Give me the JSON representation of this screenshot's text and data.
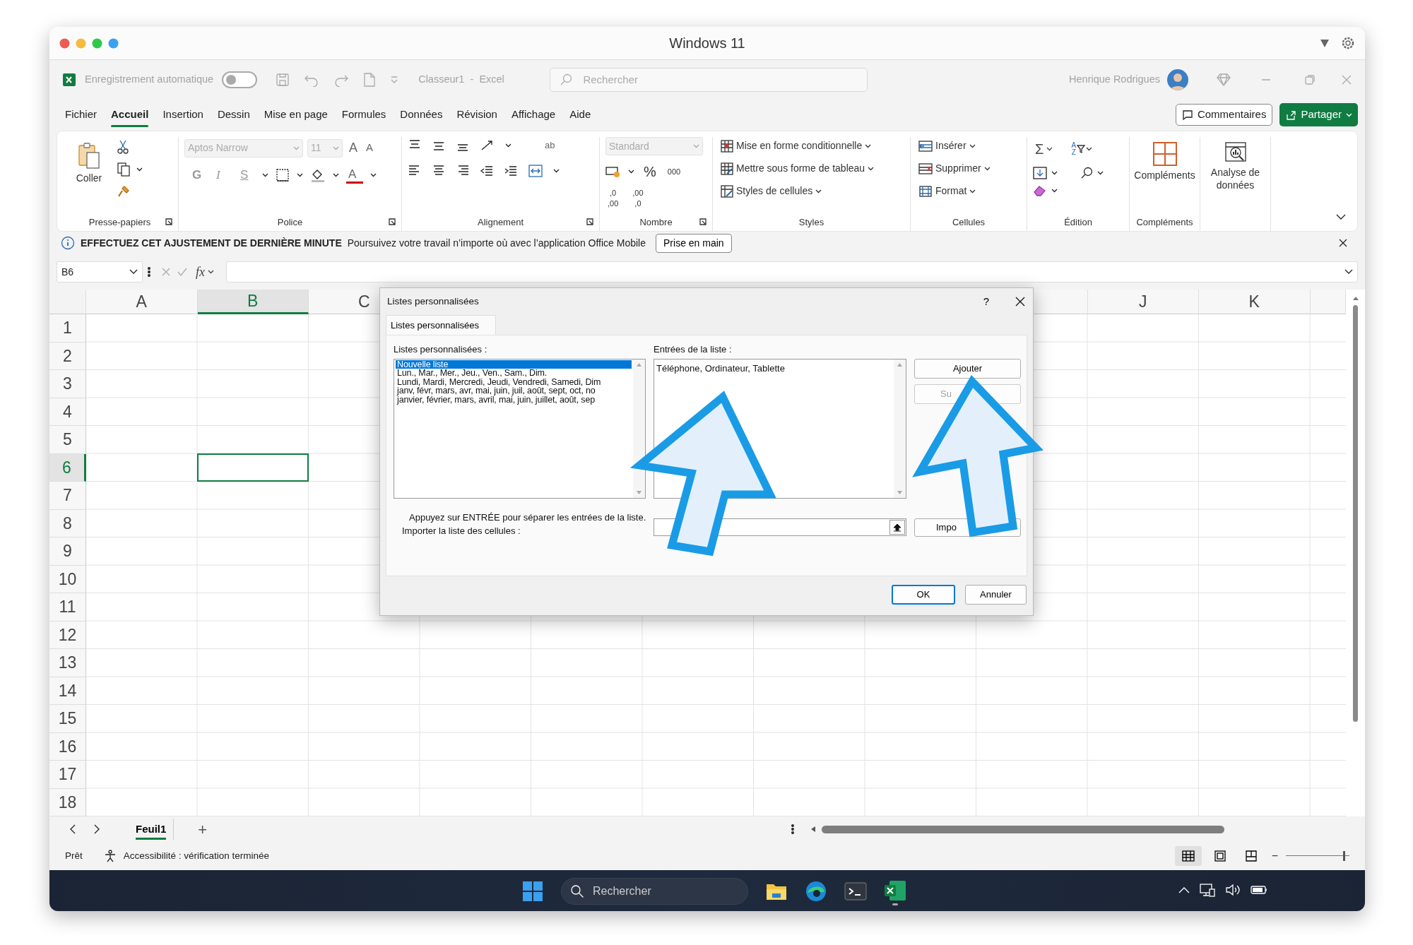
{
  "mac_titlebar": {
    "title": "Windows 11"
  },
  "app_titlebar": {
    "autosave_label": "Enregistrement automatique",
    "autosave_on": false,
    "document_title": "Classeur1  -  Excel",
    "search_placeholder": "Rechercher",
    "user_name": "Henrique Rodrigues"
  },
  "ribbon_tabs": [
    {
      "label": "Fichier",
      "selected": false
    },
    {
      "label": "Accueil",
      "selected": true
    },
    {
      "label": "Insertion",
      "selected": false
    },
    {
      "label": "Dessin",
      "selected": false
    },
    {
      "label": "Mise en page",
      "selected": false
    },
    {
      "label": "Formules",
      "selected": false
    },
    {
      "label": "Données",
      "selected": false
    },
    {
      "label": "Révision",
      "selected": false
    },
    {
      "label": "Affichage",
      "selected": false
    },
    {
      "label": "Aide",
      "selected": false
    }
  ],
  "comments_button": "Commentaires",
  "share_button": "Partager",
  "ribbon": {
    "clipboard": {
      "paste": "Coller",
      "group_label": "Presse-papiers"
    },
    "font": {
      "font_name": "Aptos Narrow",
      "font_size": "11",
      "grow": "A",
      "shrink": "A",
      "bold": "G",
      "italic": "I",
      "underline": "S",
      "font_color": "A",
      "group_label": "Police"
    },
    "alignment": {
      "wrap": "ab",
      "group_label": "Alignement"
    },
    "number": {
      "format": "Standard",
      "percent": "%",
      "thousands": "000",
      "decimals": [
        {
          "top": ",0",
          "bottom": ",00"
        },
        {
          "top": ",00",
          "bottom": ",0"
        }
      ],
      "group_label": "Nombre"
    },
    "styles": {
      "items": [
        "Mise en forme conditionnelle",
        "Mettre sous forme de tableau",
        "Styles de cellules"
      ],
      "group_label": "Styles"
    },
    "cells": {
      "items": [
        "Insérer",
        "Supprimer",
        "Format"
      ],
      "group_label": "Cellules"
    },
    "editing": {
      "sum": "Σ",
      "sort_top": "A",
      "sort_bottom": "Z",
      "group_label": "Édition"
    },
    "addins": {
      "button": "Compléments",
      "group_label": "Compléments"
    },
    "analysis": {
      "button": "Analyse de données"
    }
  },
  "info_bar": {
    "title": "EFFECTUEZ CET AJUSTEMENT DE DERNIÈRE MINUTE",
    "message": "Poursuivez votre travail n’importe où avec l’application Office Mobile",
    "button": "Prise en main"
  },
  "formula_bar": {
    "name_box": "B6",
    "fx": "fx"
  },
  "sheet": {
    "columns": [
      {
        "label": "A",
        "selected": false
      },
      {
        "label": "B",
        "selected": true
      },
      {
        "label": "C",
        "selected": false
      },
      {
        "label": "J",
        "selected": false
      },
      {
        "label": "K",
        "selected": false
      }
    ],
    "rows": [
      {
        "label": "1",
        "selected": false
      },
      {
        "label": "2",
        "selected": false
      },
      {
        "label": "3",
        "selected": false
      },
      {
        "label": "4",
        "selected": false
      },
      {
        "label": "5",
        "selected": false
      },
      {
        "label": "6",
        "selected": true
      },
      {
        "label": "7",
        "selected": false
      },
      {
        "label": "8",
        "selected": false
      },
      {
        "label": "9",
        "selected": false
      },
      {
        "label": "10",
        "selected": false
      },
      {
        "label": "11",
        "selected": false
      },
      {
        "label": "12",
        "selected": false
      },
      {
        "label": "13",
        "selected": false
      },
      {
        "label": "14",
        "selected": false
      },
      {
        "label": "15",
        "selected": false
      },
      {
        "label": "16",
        "selected": false
      },
      {
        "label": "17",
        "selected": false
      },
      {
        "label": "18",
        "selected": false
      }
    ]
  },
  "sheet_tabs": [
    {
      "label": "Feuil1",
      "selected": true
    }
  ],
  "add_sheet": "+",
  "status_bar": {
    "ready": "Prêt",
    "accessibility": "Accessibilité : vérification terminée",
    "zoom_out": "−",
    "zoom_slider": {
      "level": 0.92
    }
  },
  "taskbar": {
    "search_placeholder": "Rechercher"
  },
  "dialog": {
    "title": "Listes personnalisées",
    "help": "?",
    "tabs": [
      {
        "label": "Listes personnalisées",
        "selected": true
      }
    ],
    "lists_label": "Listes personnalisées :",
    "lists": [
      {
        "text": "Nouvelle liste",
        "selected": true
      },
      {
        "text": "Lun., Mar., Mer., Jeu., Ven., Sam., Dim.",
        "selected": false
      },
      {
        "text": "Lundi, Mardi, Mercredi, Jeudi, Vendredi, Samedi, Dim",
        "selected": false
      },
      {
        "text": "janv, févr, mars, avr, mai, juin, juil, août, sept, oct, no",
        "selected": false
      },
      {
        "text": "janvier, février, mars, avril, mai, juin, juillet, août, sep",
        "selected": false
      }
    ],
    "entries_label": "Entrées de la liste :",
    "entries": "Téléphone, Ordinateur, Tablette",
    "buttons": [
      {
        "label": "Ajouter",
        "disabled": false
      },
      {
        "label": "Su",
        "disabled": true
      }
    ],
    "hint": "Appuyez sur ENTRÉE pour séparer les entrées de la liste.",
    "import_label": "Importer la liste des cellules :",
    "import_button": {
      "label": "Impo",
      "disabled": false
    },
    "ok": "OK",
    "cancel": "Annuler"
  }
}
